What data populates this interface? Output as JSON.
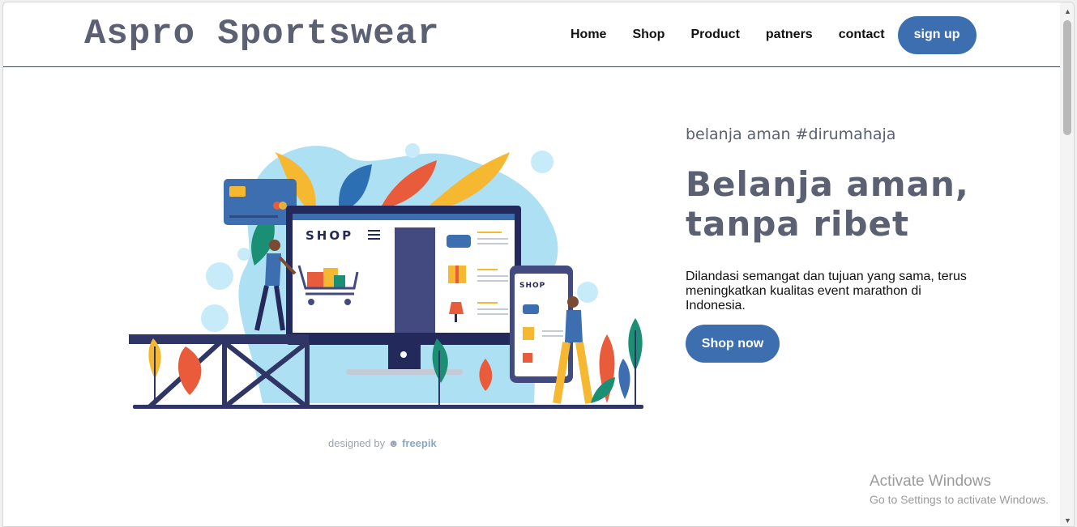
{
  "header": {
    "logo": "Aspro Sportswear",
    "nav": [
      "Home",
      "Shop",
      "Product",
      "patners",
      "contact"
    ],
    "signup_label": "sign up"
  },
  "hero": {
    "kicker": "belanja aman #dirumahaja",
    "headline": "Belanja aman, tanpa ribet",
    "description": "Dilandasi semangat dan tujuan yang sama, terus meningkatkan kualitas event marathon di Indonesia.",
    "cta_label": "Shop now"
  },
  "illustration": {
    "screen_label": "SHOP",
    "phone_label": "SHOP",
    "credit_prefix": "designed by",
    "credit_brand": "freepik"
  },
  "watermark": {
    "title": "Activate Windows",
    "subtitle": "Go to Settings to activate Windows."
  },
  "colors": {
    "accent": "#3d6fb0",
    "heading": "#5b6072",
    "divider": "#3c4a5e"
  }
}
